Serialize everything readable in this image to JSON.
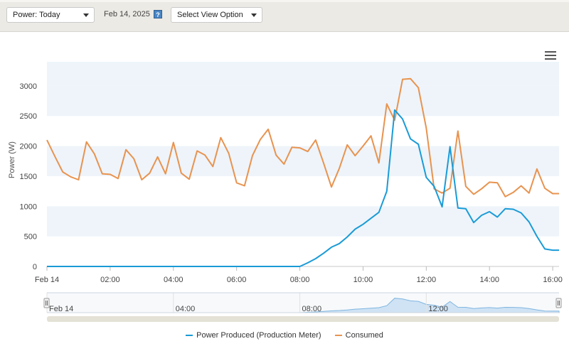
{
  "toolbar": {
    "power_select": "Power: Today",
    "date": "Feb 14, 2025",
    "help_icon": "?",
    "view_select": "Select View Option"
  },
  "chart_data": {
    "type": "line",
    "ylabel": "Power (W)",
    "ylim": [
      0,
      3400
    ],
    "yticks": [
      0,
      500,
      1000,
      1500,
      2000,
      2500,
      3000
    ],
    "xlim": [
      0,
      16.2
    ],
    "xticks": [
      {
        "v": 0,
        "label": "Feb 14"
      },
      {
        "v": 2,
        "label": "02:00"
      },
      {
        "v": 4,
        "label": "04:00"
      },
      {
        "v": 6,
        "label": "06:00"
      },
      {
        "v": 8,
        "label": "08:00"
      },
      {
        "v": 10,
        "label": "10:00"
      },
      {
        "v": 12,
        "label": "12:00"
      },
      {
        "v": 14,
        "label": "14:00"
      },
      {
        "v": 16,
        "label": "16:00"
      }
    ],
    "navigator_labels": [
      {
        "v": 0,
        "label": "Feb 14"
      },
      {
        "v": 4,
        "label": "04:00"
      },
      {
        "v": 8,
        "label": "08:00"
      },
      {
        "v": 12,
        "label": "12:00"
      }
    ],
    "grid": "alternating bands",
    "legend_position": "bottom",
    "series": [
      {
        "name": "Power Produced (Production Meter)",
        "color": "#1a9bd7",
        "x": [
          0,
          8.0,
          8.25,
          8.5,
          8.75,
          9.0,
          9.25,
          9.5,
          9.75,
          10.0,
          10.25,
          10.5,
          10.75,
          11.0,
          11.25,
          11.5,
          11.75,
          12.0,
          12.25,
          12.5,
          12.75,
          13.0,
          13.25,
          13.5,
          13.75,
          14.0,
          14.25,
          14.5,
          14.75,
          15.0,
          15.25,
          15.5,
          15.75,
          16.0,
          16.2
        ],
        "y": [
          0,
          0,
          60,
          130,
          220,
          320,
          380,
          490,
          620,
          700,
          800,
          900,
          1250,
          2600,
          2450,
          2120,
          2030,
          1480,
          1330,
          990,
          1990,
          970,
          960,
          730,
          850,
          910,
          820,
          960,
          950,
          890,
          740,
          500,
          290,
          270,
          270
        ]
      },
      {
        "name": "Consumed",
        "color": "#e8934f",
        "x": [
          0,
          0.25,
          0.5,
          0.75,
          1.0,
          1.25,
          1.5,
          1.75,
          2.0,
          2.25,
          2.5,
          2.75,
          3.0,
          3.25,
          3.5,
          3.75,
          4.0,
          4.25,
          4.5,
          4.75,
          5.0,
          5.25,
          5.5,
          5.75,
          6.0,
          6.25,
          6.5,
          6.75,
          7.0,
          7.25,
          7.5,
          7.75,
          8.0,
          8.25,
          8.5,
          8.75,
          9.0,
          9.25,
          9.5,
          9.75,
          10.0,
          10.25,
          10.5,
          10.75,
          11.0,
          11.25,
          11.5,
          11.75,
          12.0,
          12.25,
          12.5,
          12.75,
          13.0,
          13.25,
          13.5,
          13.75,
          14.0,
          14.25,
          14.5,
          14.75,
          15.0,
          15.25,
          15.5,
          15.75,
          16.0,
          16.2
        ],
        "y": [
          2100,
          1830,
          1570,
          1490,
          1440,
          2070,
          1870,
          1540,
          1530,
          1460,
          1940,
          1790,
          1440,
          1550,
          1820,
          1540,
          2060,
          1550,
          1450,
          1920,
          1850,
          1660,
          2140,
          1880,
          1390,
          1340,
          1840,
          2110,
          2280,
          1850,
          1700,
          1980,
          1970,
          1910,
          2100,
          1720,
          1320,
          1630,
          2020,
          1840,
          2000,
          2170,
          1720,
          2700,
          2430,
          3110,
          3120,
          2970,
          2300,
          1290,
          1220,
          1300,
          2250,
          1330,
          1200,
          1290,
          1400,
          1390,
          1160,
          1230,
          1340,
          1220,
          1620,
          1300,
          1210,
          1210
        ]
      }
    ]
  }
}
